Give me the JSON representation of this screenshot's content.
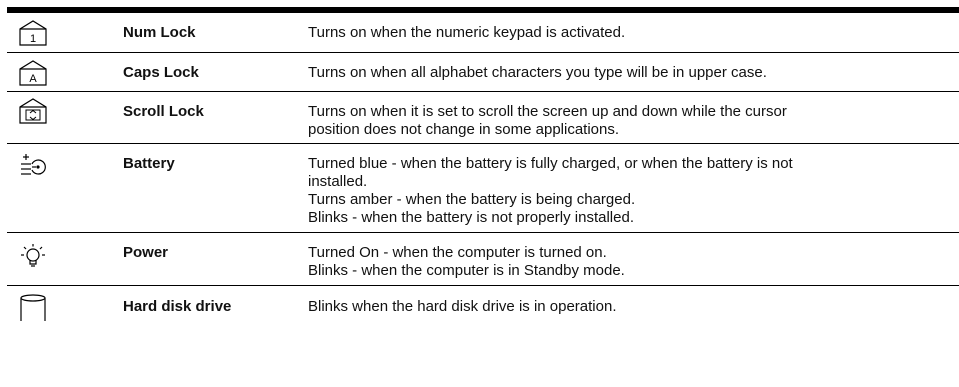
{
  "indicators": [
    {
      "icon": "num-lock-icon",
      "name": "Num Lock",
      "lines": [
        "Turns on when the numeric keypad is activated."
      ]
    },
    {
      "icon": "caps-lock-icon",
      "name": "Caps Lock",
      "lines": [
        "Turns on when all alphabet characters you type will be in upper case."
      ]
    },
    {
      "icon": "scroll-lock-icon",
      "name": "Scroll Lock",
      "lines": [
        "Turns on when it is set to scroll the screen up and down while the cursor",
        "position does not change in some applications."
      ]
    },
    {
      "icon": "battery-icon",
      "name": "Battery",
      "lines": [
        "Turned blue - when the battery is fully charged, or when the battery is not",
        "installed.",
        "Turns amber - when the battery is being charged.",
        "Blinks - when the battery is not properly installed."
      ]
    },
    {
      "icon": "power-icon",
      "name": "Power",
      "lines": [
        "Turned On - when the computer is turned on.",
        "Blinks - when the computer is in Standby mode."
      ]
    },
    {
      "icon": "hard-disk-drive-icon",
      "name": "Hard disk drive",
      "lines": [
        "Blinks when the hard disk drive is in operation."
      ]
    }
  ],
  "num_lock_key_label": "1",
  "caps_lock_key_label": "A"
}
